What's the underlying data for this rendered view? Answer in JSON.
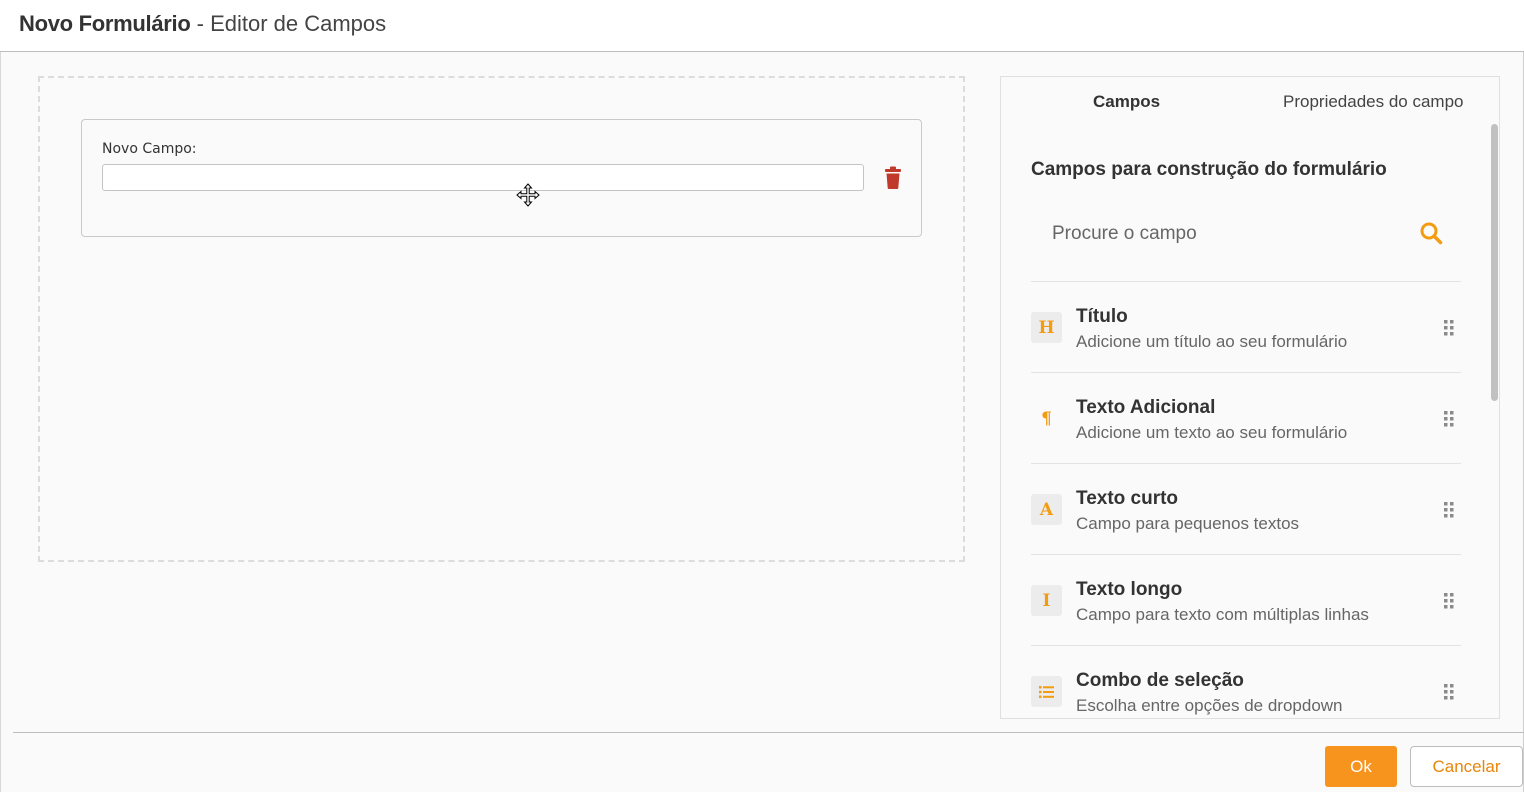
{
  "header": {
    "title_bold": "Novo Formulário",
    "title_rest": " - Editor de Campos"
  },
  "canvas": {
    "field": {
      "label": "Novo Campo:",
      "value": ""
    }
  },
  "panel": {
    "tabs": [
      {
        "label": "Campos",
        "active": true
      },
      {
        "label": "Propriedades do campo",
        "active": false
      }
    ],
    "section_title": "Campos para construção do formulário",
    "search": {
      "placeholder": "Procure o campo",
      "value": ""
    },
    "items": [
      {
        "icon": "H",
        "icon_name": "heading-icon",
        "name": "Título",
        "desc": "Adicione um título ao seu formulário"
      },
      {
        "icon": "¶",
        "icon_name": "paragraph-icon",
        "name": "Texto Adicional",
        "desc": "Adicione um texto ao seu formulário"
      },
      {
        "icon": "A",
        "icon_name": "font-icon",
        "name": "Texto curto",
        "desc": "Campo para pequenos textos"
      },
      {
        "icon": "I",
        "icon_name": "text-cursor-icon",
        "name": "Texto longo",
        "desc": "Campo para texto com múltiplas linhas"
      },
      {
        "icon": "list",
        "icon_name": "list-icon",
        "name": "Combo de seleção",
        "desc": "Escolha entre opções de dropdown"
      }
    ]
  },
  "footer": {
    "ok_label": "Ok",
    "cancel_label": "Cancelar"
  },
  "colors": {
    "accent": "#f7941d",
    "danger": "#c0392b",
    "icon_accent": "#f39c12"
  }
}
